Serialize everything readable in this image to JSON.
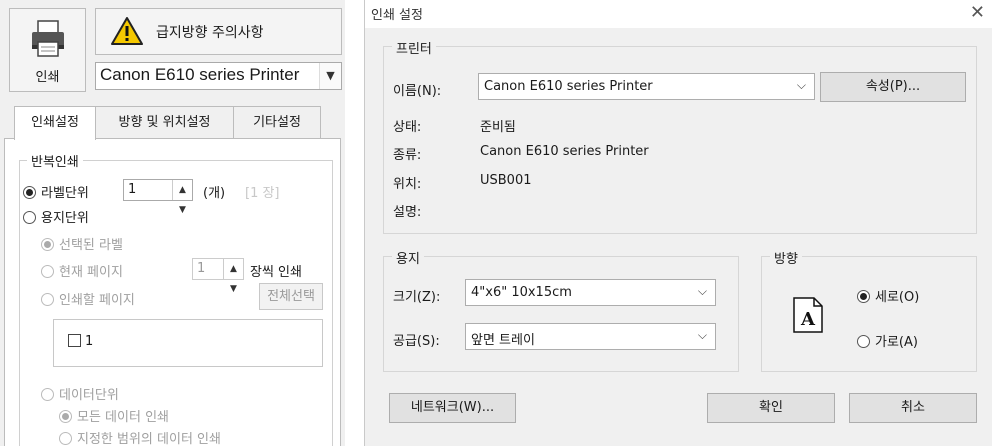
{
  "left": {
    "print_label": "인쇄",
    "warning_label": "급지방향 주의사항",
    "printer_select": "Canon E610 series Printer",
    "tabs": [
      {
        "label": "인쇄설정"
      },
      {
        "label": "방향 및 위치설정"
      },
      {
        "label": "기타설정"
      }
    ],
    "repeat_group": "반복인쇄",
    "label_unit": "라벨단위",
    "label_count": "1",
    "label_count_unit": "(개)",
    "label_pages": "[1 장]",
    "paper_unit": "용지단위",
    "selected_label": "선택된 라벨",
    "current_page": "현재 페이지",
    "page_count": "1",
    "copies_suffix": "장씩 인쇄",
    "pages_to_print": "인쇄할 페이지",
    "select_all": "전체선택",
    "page_item": "1",
    "data_unit": "데이터단위",
    "all_data": "모든 데이터 인쇄",
    "range_data": "지정한 범위의 데이터 인쇄"
  },
  "dialog": {
    "title": "인쇄 설정",
    "close": "✕",
    "printer": {
      "group": "프린터",
      "name_label": "이름(N):",
      "name_value": "Canon E610 series Printer",
      "properties": "속성(P)...",
      "status_label": "상태:",
      "status_value": "준비됨",
      "type_label": "종류:",
      "type_value": "Canon E610 series Printer",
      "where_label": "위치:",
      "where_value": "USB001",
      "comment_label": "설명:"
    },
    "paper": {
      "group": "용지",
      "size_label": "크기(Z):",
      "size_value": "4\"x6\" 10x15cm",
      "source_label": "공급(S):",
      "source_value": "앞면 트레이"
    },
    "orientation": {
      "group": "방향",
      "portrait": "세로(O)",
      "landscape": "가로(A)",
      "icon_letter": "A"
    },
    "buttons": {
      "network": "네트워크(W)...",
      "ok": "확인",
      "cancel": "취소"
    }
  },
  "colors": {
    "window_bg": "#f0f0f0",
    "warning_yellow": "#f5c800"
  }
}
